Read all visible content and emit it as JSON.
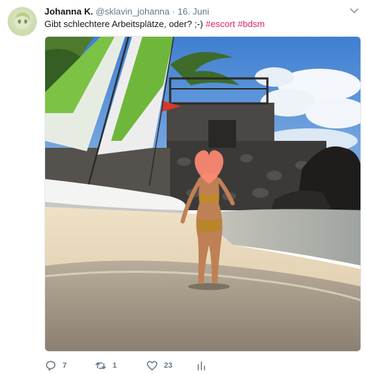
{
  "tweet": {
    "display_name": "Johanna K.",
    "handle": "@sklavin_johanna",
    "separator": "·",
    "date": "16. Juni",
    "text": "Gibt schlechtere Arbeitsplätze, oder? ;-)",
    "hashtags": [
      "#escort",
      "#bdsm"
    ]
  },
  "actions": {
    "reply_count": "7",
    "retweet_count": "1",
    "like_count": "23"
  },
  "colors": {
    "hashtag": "#e0245e",
    "muted": "#657786",
    "text": "#14171a"
  },
  "icons": {
    "reply": "reply-icon",
    "retweet": "retweet-icon",
    "like": "heart-icon",
    "analytics": "analytics-icon",
    "menu": "chevron-down-icon"
  }
}
